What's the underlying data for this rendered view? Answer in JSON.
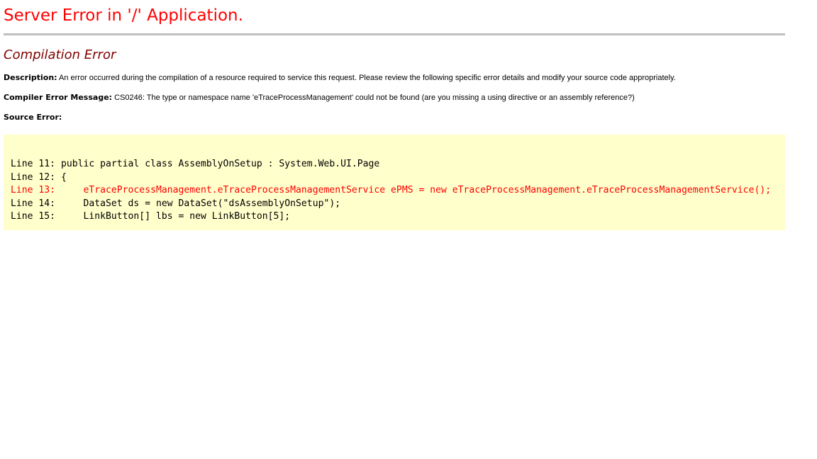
{
  "page": {
    "title": "Server Error in '/' Application.",
    "subtitle": "Compilation Error"
  },
  "description": {
    "label": "Description:",
    "text": " An error occurred during the compilation of a resource required to service this request. Please review the following specific error details and modify your source code appropriately."
  },
  "compiler_error": {
    "label": "Compiler Error Message:",
    "text": " CS0246: The type or namespace name 'eTraceProcessManagement' could not be found (are you missing a using directive or an assembly reference?)"
  },
  "source_error": {
    "label": "Source Error:",
    "lines": [
      {
        "text": "Line 11: public partial class AssemblyOnSetup : System.Web.UI.Page",
        "is_error": false
      },
      {
        "text": "Line 12: {",
        "is_error": false
      },
      {
        "text": "Line 13:     eTraceProcessManagement.eTraceProcessManagementService ePMS = new eTraceProcessManagement.eTraceProcessManagementService();",
        "is_error": true
      },
      {
        "text": "Line 14:     DataSet ds = new DataSet(\"dsAssemblyOnSetup\");",
        "is_error": false
      },
      {
        "text": "Line 15:     LinkButton[] lbs = new LinkButton[5];",
        "is_error": false
      }
    ]
  },
  "colors": {
    "title": "#ff0000",
    "subtitle": "#800000",
    "code_background": "#ffffcc",
    "error_line": "#ff0000",
    "rule": "#c0c0c0"
  }
}
